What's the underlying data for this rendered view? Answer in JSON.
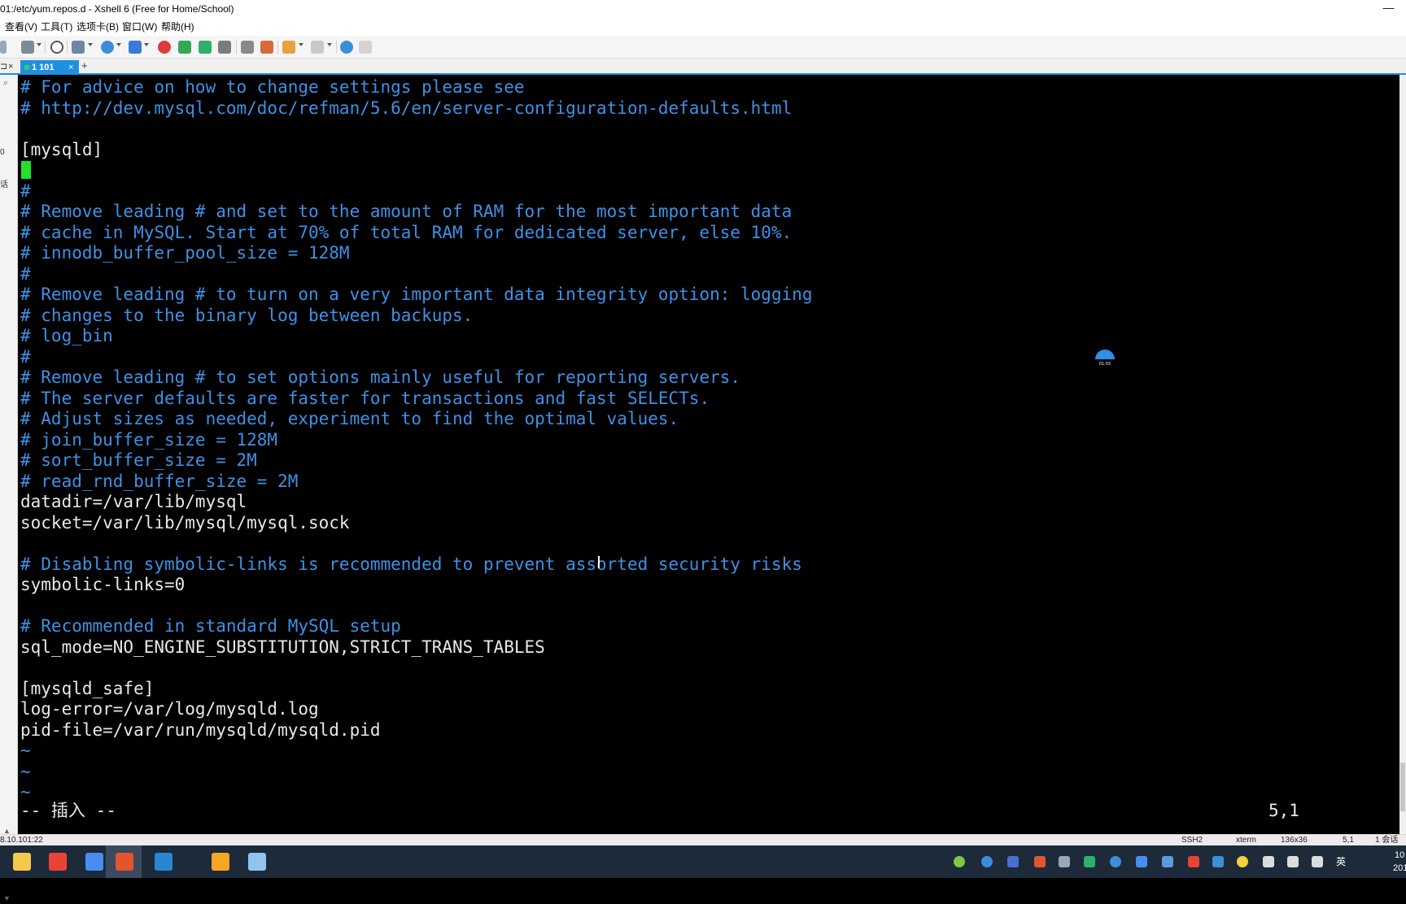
{
  "window": {
    "title": "01:/etc/yum.repos.d - Xshell 6 (Free for Home/School)",
    "minimize_glyph": "—"
  },
  "menu": {
    "items": [
      "查看(V)",
      "工具(T)",
      "选项卡(B)",
      "窗口(W)",
      "帮助(H)"
    ]
  },
  "toolbar": {
    "icons": [
      "new-session-icon",
      "search-icon",
      "sftp-icon",
      "globe-icon",
      "font-icon",
      "record-icon",
      "script-icon",
      "fullscreen-icon",
      "lock-icon",
      "keyboard-icon",
      "compose-icon",
      "transfer-icon",
      "layout-icon",
      "help-icon",
      "chat-icon"
    ]
  },
  "tabs": {
    "pin_glyph": "⊐",
    "close_glyph": "×",
    "session_label": "1 101",
    "session_close": "×",
    "add_glyph": "+"
  },
  "left_panel": {
    "search_glyph": "⌕",
    "frag1": "0",
    "frag2": "话"
  },
  "terminal": {
    "lines": [
      {
        "text": "# For advice on how to change settings please see",
        "kind": "comment"
      },
      {
        "text": "# http://dev.mysql.com/doc/refman/5.6/en/server-configuration-defaults.html",
        "kind": "comment"
      },
      {
        "text": "",
        "kind": "text"
      },
      {
        "text": "[mysqld]",
        "kind": "text"
      },
      {
        "text": "",
        "kind": "text"
      },
      {
        "text": "#",
        "kind": "comment"
      },
      {
        "text": "# Remove leading # and set to the amount of RAM for the most important data",
        "kind": "comment"
      },
      {
        "text": "# cache in MySQL. Start at 70% of total RAM for dedicated server, else 10%.",
        "kind": "comment"
      },
      {
        "text": "# innodb_buffer_pool_size = 128M",
        "kind": "comment"
      },
      {
        "text": "#",
        "kind": "comment"
      },
      {
        "text": "# Remove leading # to turn on a very important data integrity option: logging",
        "kind": "comment"
      },
      {
        "text": "# changes to the binary log between backups.",
        "kind": "comment"
      },
      {
        "text": "# log_bin",
        "kind": "comment"
      },
      {
        "text": "#",
        "kind": "comment"
      },
      {
        "text": "# Remove leading # to set options mainly useful for reporting servers.",
        "kind": "comment"
      },
      {
        "text": "# The server defaults are faster for transactions and fast SELECTs.",
        "kind": "comment"
      },
      {
        "text": "# Adjust sizes as needed, experiment to find the optimal values.",
        "kind": "comment"
      },
      {
        "text": "# join_buffer_size = 128M",
        "kind": "comment"
      },
      {
        "text": "# sort_buffer_size = 2M",
        "kind": "comment"
      },
      {
        "text": "# read_rnd_buffer_size = 2M",
        "kind": "comment"
      },
      {
        "text": "datadir=/var/lib/mysql",
        "kind": "text"
      },
      {
        "text": "socket=/var/lib/mysql/mysql.sock",
        "kind": "text"
      },
      {
        "text": "",
        "kind": "text"
      },
      {
        "text": "# Disabling symbolic-links is recommended to prevent assorted security risks",
        "kind": "comment"
      },
      {
        "text": "symbolic-links=0",
        "kind": "text"
      },
      {
        "text": "",
        "kind": "text"
      },
      {
        "text": "# Recommended in standard MySQL setup",
        "kind": "comment"
      },
      {
        "text": "sql_mode=NO_ENGINE_SUBSTITUTION,STRICT_TRANS_TABLES",
        "kind": "text"
      },
      {
        "text": "",
        "kind": "text"
      },
      {
        "text": "[mysqld_safe]",
        "kind": "text"
      },
      {
        "text": "log-error=/var/log/mysqld.log",
        "kind": "text"
      },
      {
        "text": "pid-file=/var/run/mysqld/mysqld.pid",
        "kind": "text"
      },
      {
        "text": "~",
        "kind": "tilde"
      },
      {
        "text": "~",
        "kind": "tilde"
      },
      {
        "text": "~",
        "kind": "tilde"
      }
    ],
    "mode": "-- 插入 --",
    "position": "5,1",
    "ibeam": "I",
    "timer_label": "01:55"
  },
  "statusbar": {
    "host": "8.10.101:22",
    "protocol": "SSH2",
    "terminal": "xterm",
    "size": "136x36",
    "cursor": "5,1",
    "sessions": "1 会话",
    "scroll_up": "▲",
    "scroll_down": "▼"
  },
  "taskbar": {
    "apps": [
      {
        "name": "file-explorer-icon",
        "color": "#f2c94c"
      },
      {
        "name": "chrome-icon",
        "color": "#e94335"
      },
      {
        "name": "feishu-icon",
        "color": "#4a8df0"
      },
      {
        "name": "xshell-icon",
        "color": "#e2552d"
      },
      {
        "name": "vscode-icon",
        "color": "#2a86d1"
      },
      {
        "name": "box-icon",
        "color": "#f5a623"
      },
      {
        "name": "notepad-icon",
        "color": "#8fc3f0"
      }
    ],
    "ime": "英",
    "clock_time": "10",
    "clock_date": "201"
  }
}
